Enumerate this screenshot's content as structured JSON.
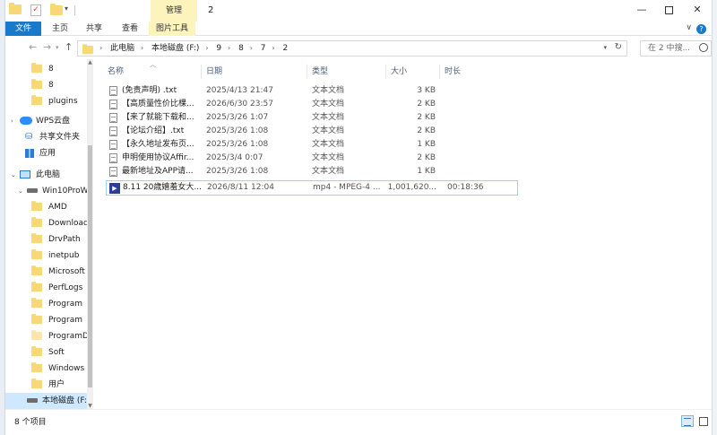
{
  "window": {
    "title": "2",
    "manage_tab": "管理",
    "controls": {
      "minimize": "—",
      "maximize": "",
      "close": "✕"
    }
  },
  "ribbon": {
    "tabs": [
      "文件",
      "主页",
      "共享",
      "查看",
      "图片工具"
    ],
    "expand": "∨",
    "help": "?"
  },
  "address": {
    "back": "←",
    "forward": "→",
    "up": "↑",
    "crumbs": [
      "此电脑",
      "本地磁盘 (F:)",
      "9",
      "8",
      "7",
      "2"
    ],
    "separator": "›",
    "search_placeholder": "在 2 中搜..."
  },
  "nav": {
    "items": [
      {
        "label": "8",
        "icon": "folder-icon"
      },
      {
        "label": "8",
        "icon": "folder-icon"
      },
      {
        "label": "plugins",
        "icon": "folder-icon"
      },
      {
        "label": "WPS云盘",
        "icon": "cloud-icon"
      },
      {
        "label": "共享文件夹",
        "icon": "share-icon"
      },
      {
        "label": "应用",
        "icon": "apps-icon"
      },
      {
        "label": "此电脑",
        "icon": "computer-icon"
      },
      {
        "label": "Win10ProW",
        "icon": "drive-icon"
      },
      {
        "label": "AMD",
        "icon": "folder-icon"
      },
      {
        "label": "Downloads",
        "icon": "folder-icon"
      },
      {
        "label": "DrvPath",
        "icon": "folder-icon"
      },
      {
        "label": "inetpub",
        "icon": "folder-icon"
      },
      {
        "label": "Microsoft",
        "icon": "folder-icon"
      },
      {
        "label": "PerfLogs",
        "icon": "folder-icon"
      },
      {
        "label": "Program",
        "icon": "folder-icon"
      },
      {
        "label": "Program",
        "icon": "folder-icon"
      },
      {
        "label": "ProgramD",
        "icon": "folder-icon"
      },
      {
        "label": "Soft",
        "icon": "folder-icon"
      },
      {
        "label": "Windows",
        "icon": "folder-icon"
      },
      {
        "label": "用户",
        "icon": "folder-icon"
      },
      {
        "label": "本地磁盘 (F:)",
        "icon": "drive-icon"
      }
    ]
  },
  "columns": {
    "name": "名称",
    "date": "日期",
    "type": "类型",
    "size": "大小",
    "duration": "时长"
  },
  "files": [
    {
      "name": "(免责声明) .txt",
      "date": "2025/4/13 21:47",
      "type": "文本文档",
      "size": "3 KB",
      "duration": "",
      "icon": "text-file-icon"
    },
    {
      "name": "【高质量性价比棵...",
      "date": "2026/6/30 23:57",
      "type": "文本文档",
      "size": "2 KB",
      "duration": "",
      "icon": "text-file-icon"
    },
    {
      "name": "【来了就能下载和...",
      "date": "2025/3/26 1:07",
      "type": "文本文档",
      "size": "2 KB",
      "duration": "",
      "icon": "text-file-icon"
    },
    {
      "name": "【论坛介绍】.txt",
      "date": "2025/3/26 1:08",
      "type": "文本文档",
      "size": "2 KB",
      "duration": "",
      "icon": "text-file-icon"
    },
    {
      "name": "【永久地址发布页...",
      "date": "2025/3/26 1:08",
      "type": "文本文档",
      "size": "1 KB",
      "duration": "",
      "icon": "text-file-icon"
    },
    {
      "name": "申明使用协议Affir...",
      "date": "2025/3/4 0:07",
      "type": "文本文档",
      "size": "2 KB",
      "duration": "",
      "icon": "text-file-icon"
    },
    {
      "name": "最新地址及APP请...",
      "date": "2025/3/26 1:08",
      "type": "文本文档",
      "size": "1 KB",
      "duration": "",
      "icon": "text-file-icon"
    },
    {
      "name": "8.11 20歳嬉羞女大...",
      "date": "2026/8/11 12:04",
      "type": "mp4 - MPEG-4 ...",
      "size": "1,001,620...",
      "duration": "00:18:36",
      "icon": "video-file-icon"
    }
  ],
  "status": {
    "count": "8 个项目"
  }
}
